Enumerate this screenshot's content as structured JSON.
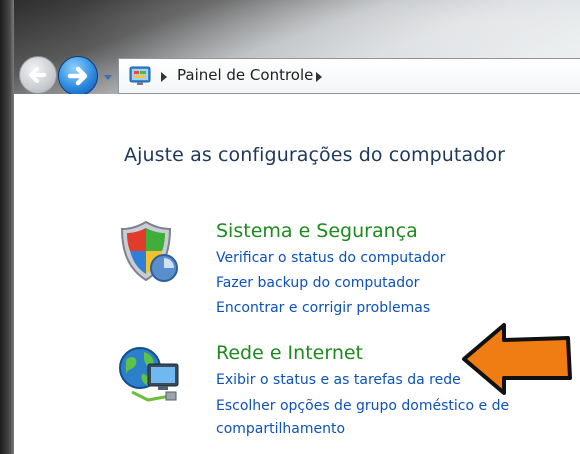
{
  "breadcrumb": {
    "label": "Painel de Controle"
  },
  "heading": "Ajuste as configurações do computador",
  "categories": [
    {
      "title": "Sistema e Segurança",
      "icon": "security-shield-icon",
      "links": [
        "Verificar o status do computador",
        "Fazer backup do computador",
        "Encontrar e corrigir problemas"
      ]
    },
    {
      "title": "Rede e Internet",
      "icon": "network-globe-icon",
      "links": [
        "Exibir o status e as tarefas da rede",
        "Escolher opções de grupo doméstico e de",
        "compartilhamento"
      ]
    }
  ],
  "colors": {
    "heading": "#1e395b",
    "category_title": "#1e8a1e",
    "link": "#0d52b8",
    "annotation_arrow": "#f07d14"
  }
}
